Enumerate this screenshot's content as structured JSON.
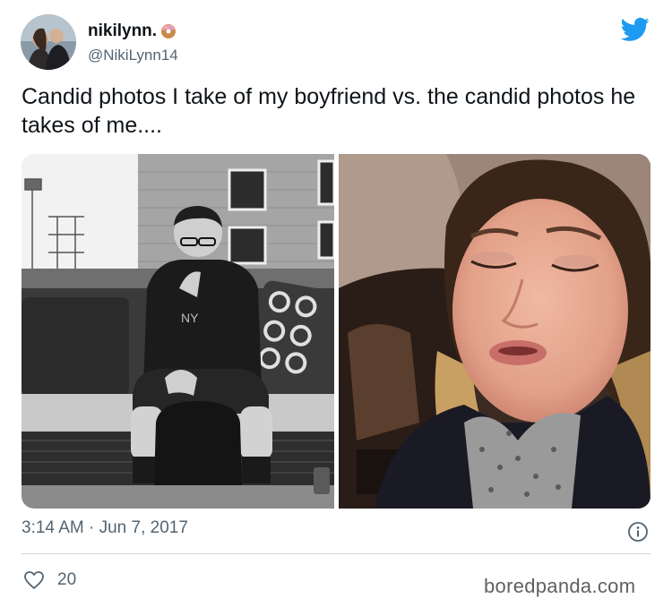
{
  "header": {
    "display_name": "nikilynn.",
    "handle": "@NikiLynn14",
    "emoji_icon": "donut-icon",
    "brand_icon": "twitter-bird-icon",
    "brand_color": "#1d9bf0"
  },
  "tweet": {
    "text": "Candid photos I take of my boyfriend vs. the candid photos he takes of me....",
    "timestamp": "3:14 AM · Jun 7, 2017",
    "like_count": "20"
  },
  "photos": [
    {
      "icon": "photo-man-seated-outdoors"
    },
    {
      "icon": "photo-woman-asleep-in-car"
    }
  ],
  "watermark": "boredpanda.com"
}
